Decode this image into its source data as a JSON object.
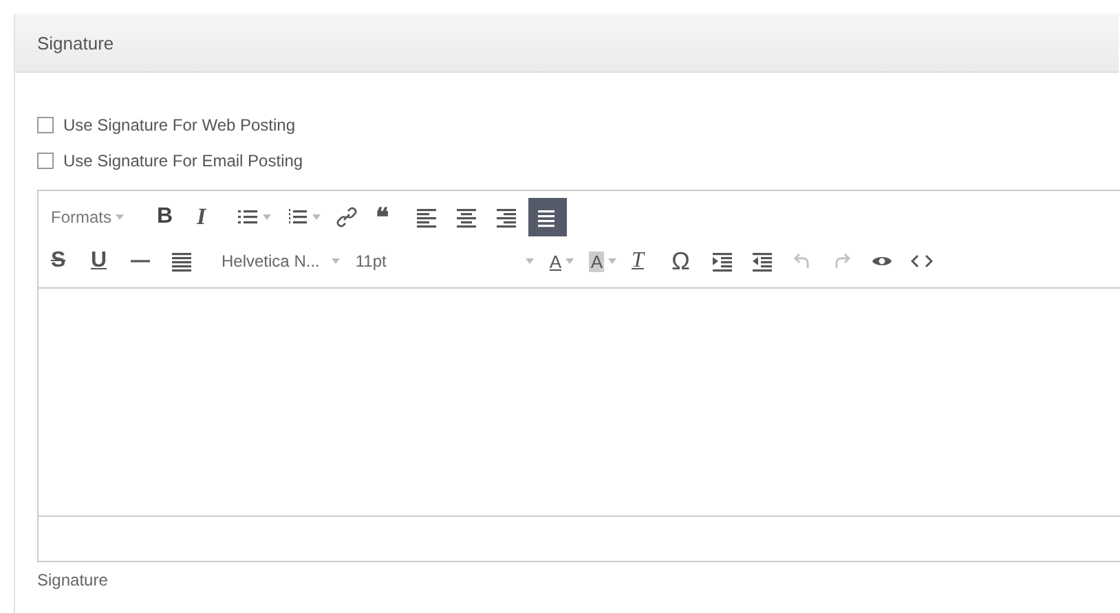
{
  "panel": {
    "title": "Signature"
  },
  "options": [
    {
      "label": "Use Signature For Web Posting",
      "checked": false
    },
    {
      "label": "Use Signature For Email Posting",
      "checked": false
    }
  ],
  "editor": {
    "toolbar_rows": [
      [
        {
          "kind": "formats",
          "label": "Formats",
          "selected": false,
          "disabled": false
        },
        {
          "kind": "bold",
          "label": "B",
          "selected": false,
          "disabled": false
        },
        {
          "kind": "italic",
          "label": "I",
          "selected": false,
          "disabled": false
        },
        {
          "kind": "bullet-list",
          "selected": false,
          "disabled": false
        },
        {
          "kind": "numbered-list",
          "selected": false,
          "disabled": false
        },
        {
          "kind": "link",
          "selected": false,
          "disabled": false
        },
        {
          "kind": "quote",
          "label": "❝",
          "selected": false,
          "disabled": false
        },
        {
          "kind": "align-left",
          "selected": false,
          "disabled": false
        },
        {
          "kind": "align-center",
          "selected": false,
          "disabled": false
        },
        {
          "kind": "align-right",
          "selected": false,
          "disabled": false
        },
        {
          "kind": "align-justify",
          "selected": true,
          "disabled": false
        }
      ],
      [
        {
          "kind": "strikethrough",
          "label": "S",
          "selected": false,
          "disabled": false
        },
        {
          "kind": "underline",
          "label": "U",
          "selected": false,
          "disabled": false
        },
        {
          "kind": "horizontal-rule",
          "selected": false,
          "disabled": false
        },
        {
          "kind": "block",
          "selected": false,
          "disabled": false
        },
        {
          "kind": "font-family",
          "label": "Helvetica N...",
          "selected": false,
          "disabled": false
        },
        {
          "kind": "font-size",
          "label": "11pt",
          "selected": false,
          "disabled": false
        },
        {
          "kind": "text-color",
          "label": "A",
          "selected": false,
          "disabled": false
        },
        {
          "kind": "background-color",
          "label": "A",
          "selected": false,
          "disabled": false
        },
        {
          "kind": "clear-format",
          "label": "T",
          "selected": false,
          "disabled": false
        },
        {
          "kind": "special-char",
          "label": "Ω",
          "selected": false,
          "disabled": false
        },
        {
          "kind": "indent",
          "selected": false,
          "disabled": false
        },
        {
          "kind": "outdent",
          "selected": false,
          "disabled": false
        },
        {
          "kind": "undo",
          "selected": false,
          "disabled": true
        },
        {
          "kind": "redo",
          "selected": false,
          "disabled": true
        },
        {
          "kind": "preview",
          "selected": false,
          "disabled": false
        },
        {
          "kind": "code",
          "selected": false,
          "disabled": false
        }
      ]
    ]
  },
  "field_label": "Signature"
}
